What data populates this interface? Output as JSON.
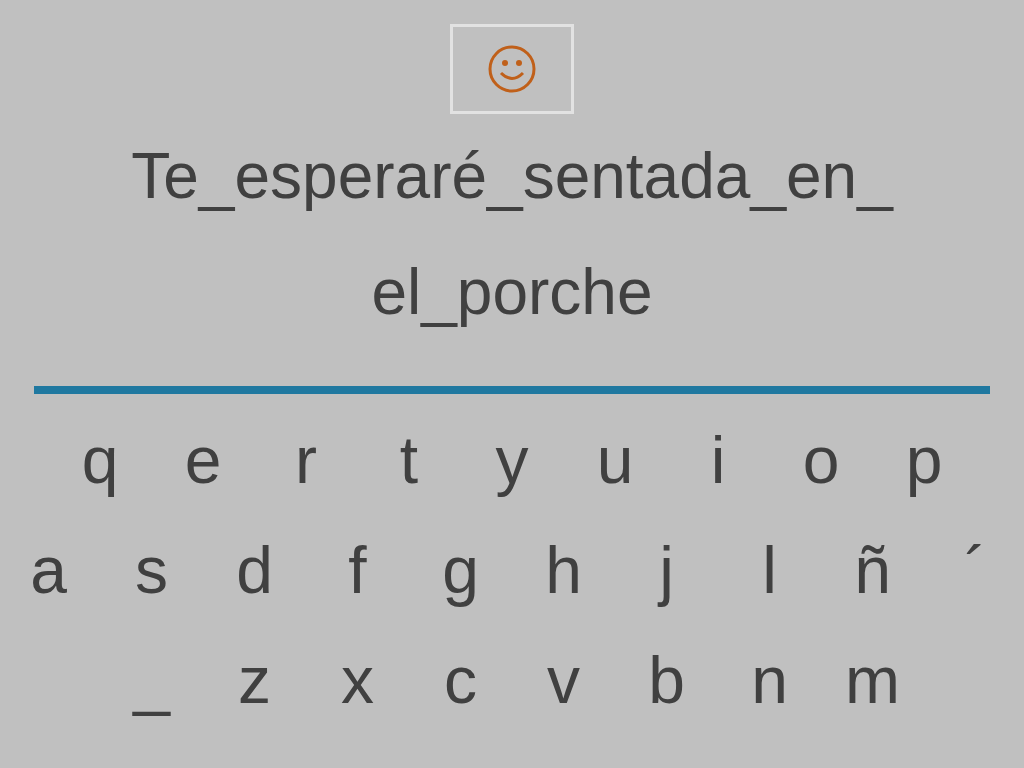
{
  "phrase_lines": [
    "Te_esperaré_sentada_en_",
    "el_porche"
  ],
  "keyboard": {
    "rows": [
      [
        "q",
        "e",
        "r",
        "t",
        "y",
        "u",
        "i",
        "o",
        "p"
      ],
      [
        "a",
        "s",
        "d",
        "f",
        "g",
        "h",
        "j",
        "l",
        "ñ",
        "´"
      ],
      [
        "_",
        "z",
        "x",
        "c",
        "v",
        "b",
        "n",
        "m"
      ]
    ]
  }
}
